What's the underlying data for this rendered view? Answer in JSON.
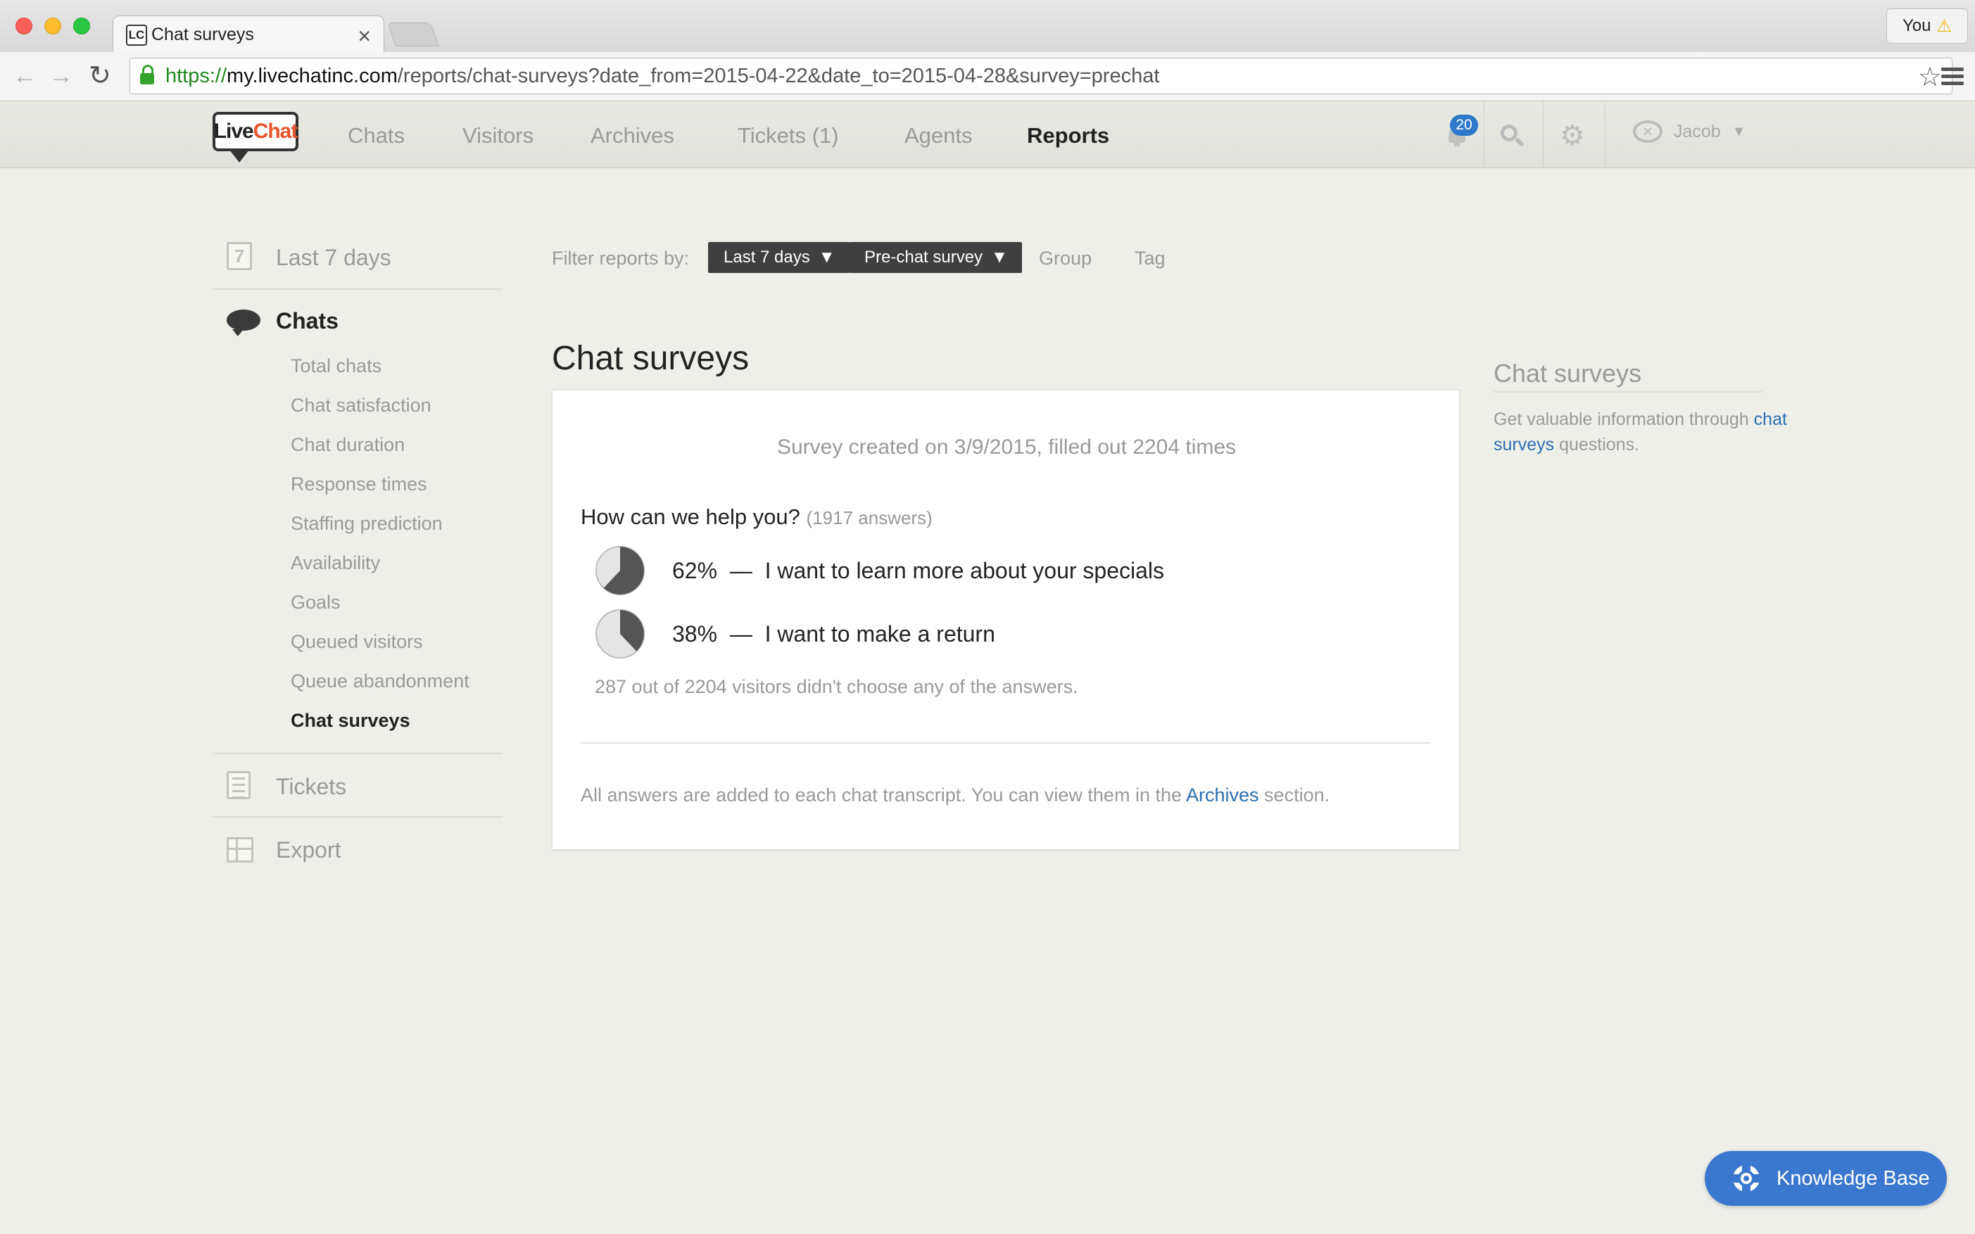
{
  "browser": {
    "tab_title": "Chat surveys",
    "tab_favicon": "LC",
    "tab_close": "×",
    "profile_label": "You",
    "url_scheme": "https://",
    "url_host": "my.livechatinc.com",
    "url_path": "/reports/chat-surveys?date_from=2015-04-22&date_to=2015-04-28&survey=prechat"
  },
  "header": {
    "logo_live": "Live",
    "logo_chat": "Chat",
    "nav": [
      {
        "label": "Chats"
      },
      {
        "label": "Visitors"
      },
      {
        "label": "Archives"
      },
      {
        "label": "Tickets (1)"
      },
      {
        "label": "Agents"
      },
      {
        "label": "Reports",
        "active": true
      }
    ],
    "notification_count": "20",
    "user_name": "Jacob"
  },
  "sidebar": {
    "date_range": "Last 7 days",
    "sections": [
      {
        "label": "Chats",
        "active": true,
        "items": [
          {
            "label": "Total chats"
          },
          {
            "label": "Chat satisfaction"
          },
          {
            "label": "Chat duration"
          },
          {
            "label": "Response times"
          },
          {
            "label": "Staffing prediction"
          },
          {
            "label": "Availability"
          },
          {
            "label": "Goals"
          },
          {
            "label": "Queued visitors"
          },
          {
            "label": "Queue abandonment"
          },
          {
            "label": "Chat surveys",
            "active": true
          }
        ]
      },
      {
        "label": "Tickets"
      },
      {
        "label": "Export"
      }
    ]
  },
  "filter": {
    "label": "Filter reports by:",
    "date_pill": "Last 7 days",
    "survey_pill": "Pre-chat survey",
    "group_link": "Group",
    "tag_link": "Tag"
  },
  "main": {
    "title": "Chat surveys",
    "survey_meta": "Survey created on 3/9/2015, filled out 2204 times",
    "question": "How can we help you?",
    "answer_count": "(1917 answers)",
    "answers": [
      {
        "percent": 62,
        "label": "62%  —  I want to learn more about your specials"
      },
      {
        "percent": 38,
        "label": "38%  —  I want to make a return"
      }
    ],
    "no_answer_note": "287 out of 2204 visitors didn't choose any of the answers.",
    "footer_before": "All answers are added to each chat transcript. You can view them in the ",
    "footer_link": "Archives",
    "footer_after": " section."
  },
  "help": {
    "title": "Chat surveys",
    "text_before": "Get valuable information through ",
    "link": "chat surveys",
    "text_after": " questions."
  },
  "kb_button": "Knowledge Base",
  "colors": {
    "accent": "#3a78cf",
    "link": "#2b6eb3",
    "pie_fill": "#555555",
    "pie_bg": "#e5e5e5"
  }
}
